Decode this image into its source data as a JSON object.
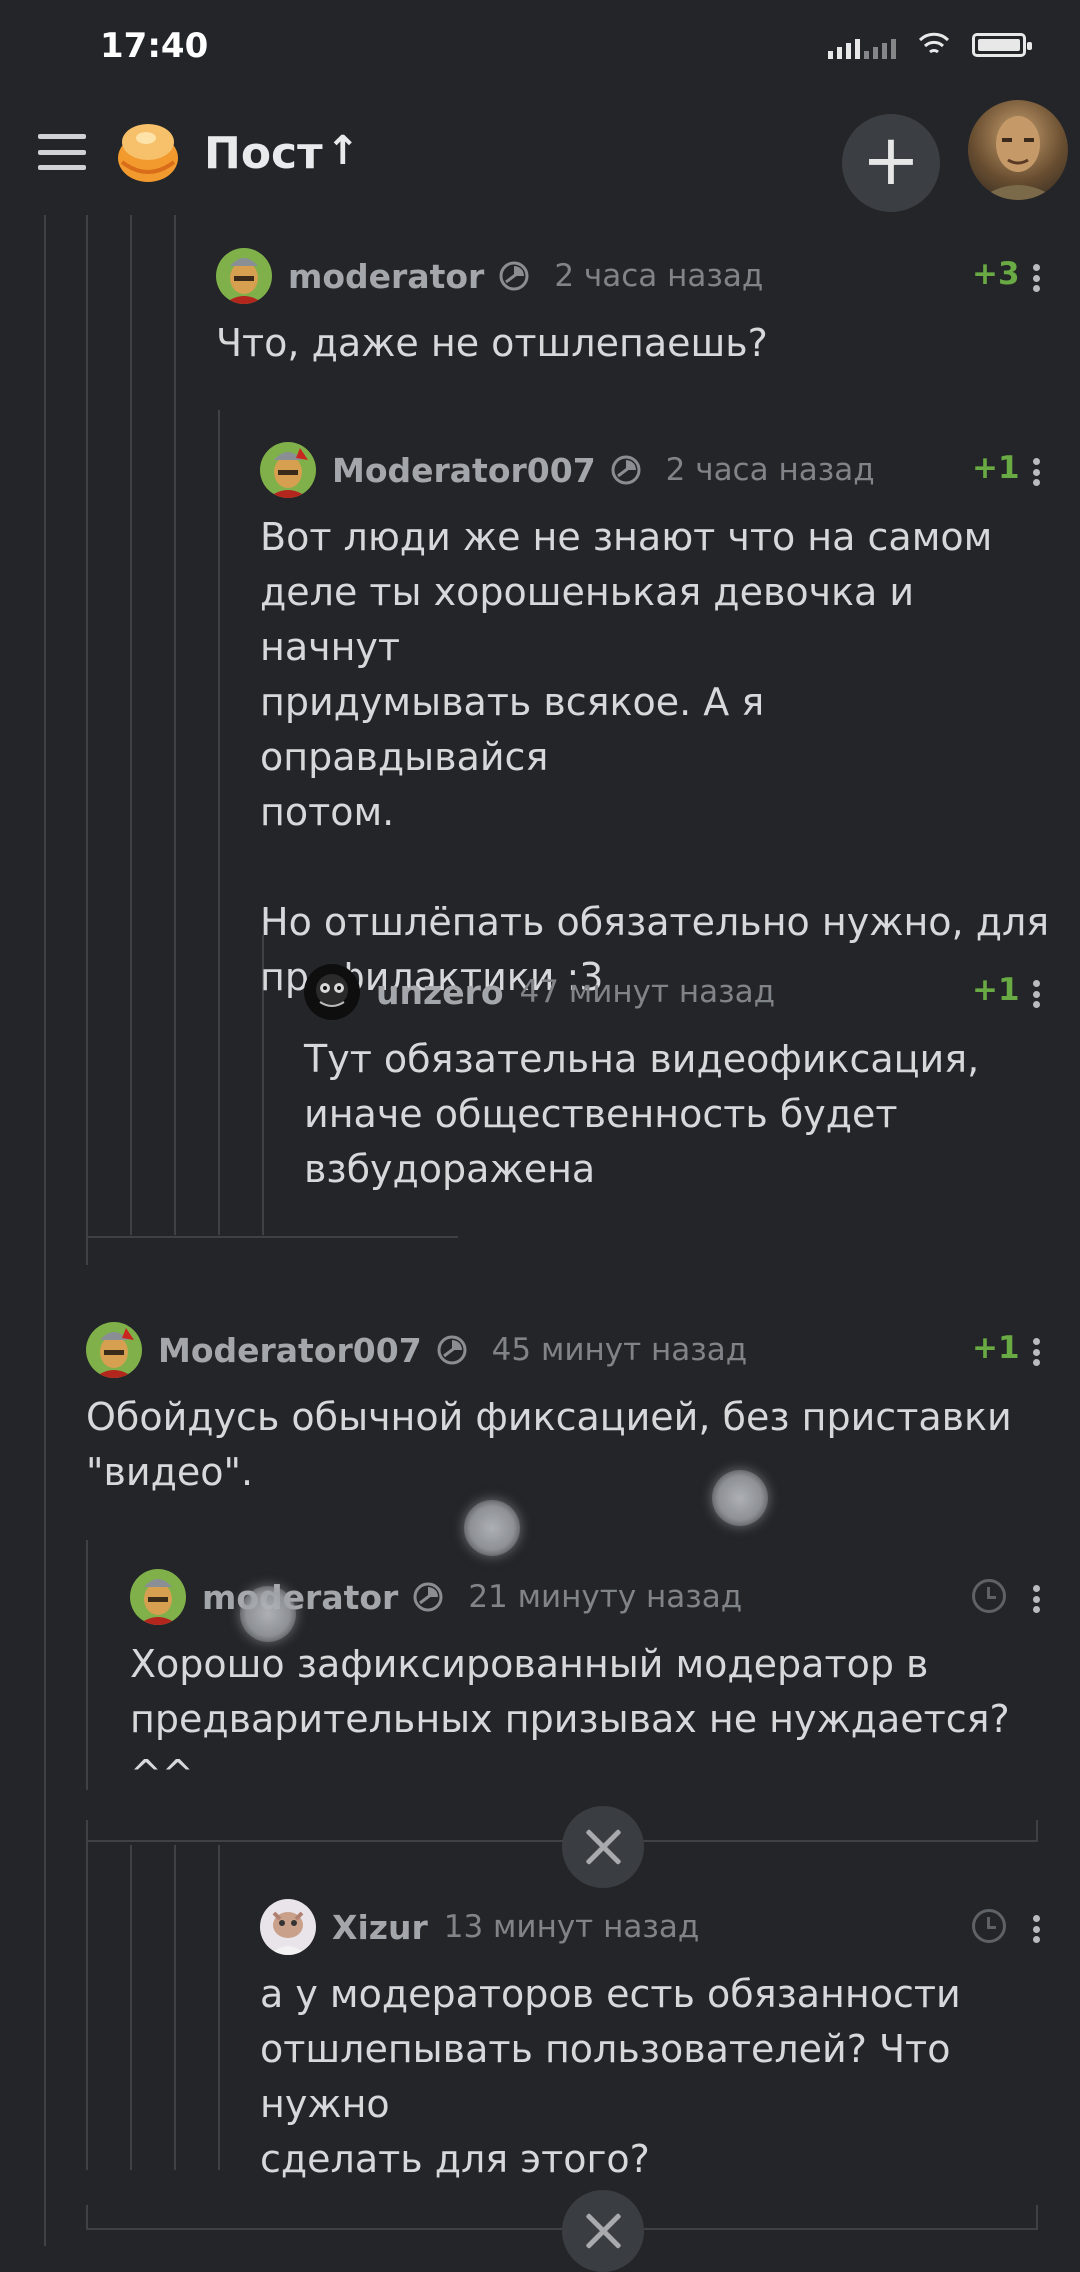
{
  "status_bar": {
    "time": "17:40"
  },
  "header": {
    "title": "Пост",
    "up_arrow": "↑",
    "add": "+"
  },
  "comments": [
    {
      "author": "moderator",
      "time": "2 часа назад",
      "rating": "+3",
      "text": "Что, даже не отшлепаешь?"
    },
    {
      "author": "Moderator007",
      "time": "2 часа назад",
      "rating": "+1",
      "text": "Вот люди же не знают что на самом\nделе ты хорошенькая девочка и начнут\nпридумывать всякое. А я оправдывайся\nпотом.\n\nНо отшлёпать обязательно нужно, для\nпрофилактики :3"
    },
    {
      "author": "unzero",
      "time": "47 минут назад",
      "rating": "+1",
      "text": "Тут обязательна видеофиксация,\nиначе общественность будет\nвзбудоражена"
    },
    {
      "author": "Moderator007",
      "time": "45 минут назад",
      "rating": "+1",
      "text": "Обойдусь обычной фиксацией, без приставки\n\"видео\"."
    },
    {
      "author": "moderator",
      "time": "21 минуту назад",
      "rating": "",
      "text": "Хорошо зафиксированный модератор в\nпредварительных призывах не нуждается?^^"
    },
    {
      "author": "Xizur",
      "time": "13 минут назад",
      "rating": "",
      "text": "а у модераторов есть обязанности\nотшлепывать пользователей? Что нужно\nсделать для этого?"
    }
  ],
  "colors": {
    "background": "#232528",
    "rating_green": "#6aaa44",
    "thread_line": "#3e4145"
  }
}
